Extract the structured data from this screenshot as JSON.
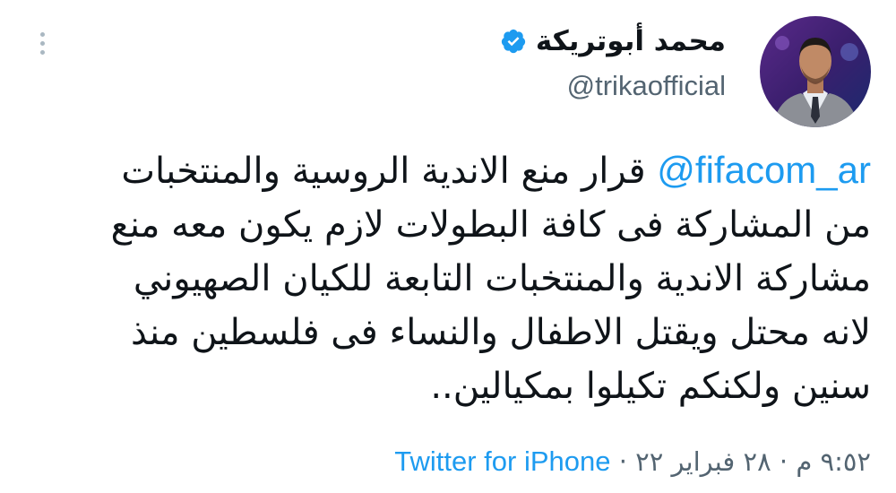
{
  "tweet": {
    "author": {
      "display_name": "محمد أبوتريكة",
      "handle": "@trikaofficial",
      "verified": true,
      "avatar_icon": "profile-photo"
    },
    "mention": "@fifacom_ar",
    "text_lines": [
      "قرار منع الاندية الروسية والمنتخبات",
      "من المشاركة فى كافة البطولات لازم يكون معه منع",
      "مشاركة الاندية والمنتخبات التابعة للكيان الصهيوني",
      "لانه محتل ويقتل الاطفال والنساء فى فلسطين منذ",
      "سنين ولكنكم تكيلوا بمكيالين.."
    ],
    "time": "٩:٥٢ م",
    "date": "٢٨ فبراير ٢٢",
    "separator": "·",
    "source": "Twitter for iPhone"
  },
  "colors": {
    "link": "#1d9bf0",
    "secondary_text": "#536471",
    "verified_badge": "#1d9bf0",
    "more_dots": "#aab8c2"
  }
}
